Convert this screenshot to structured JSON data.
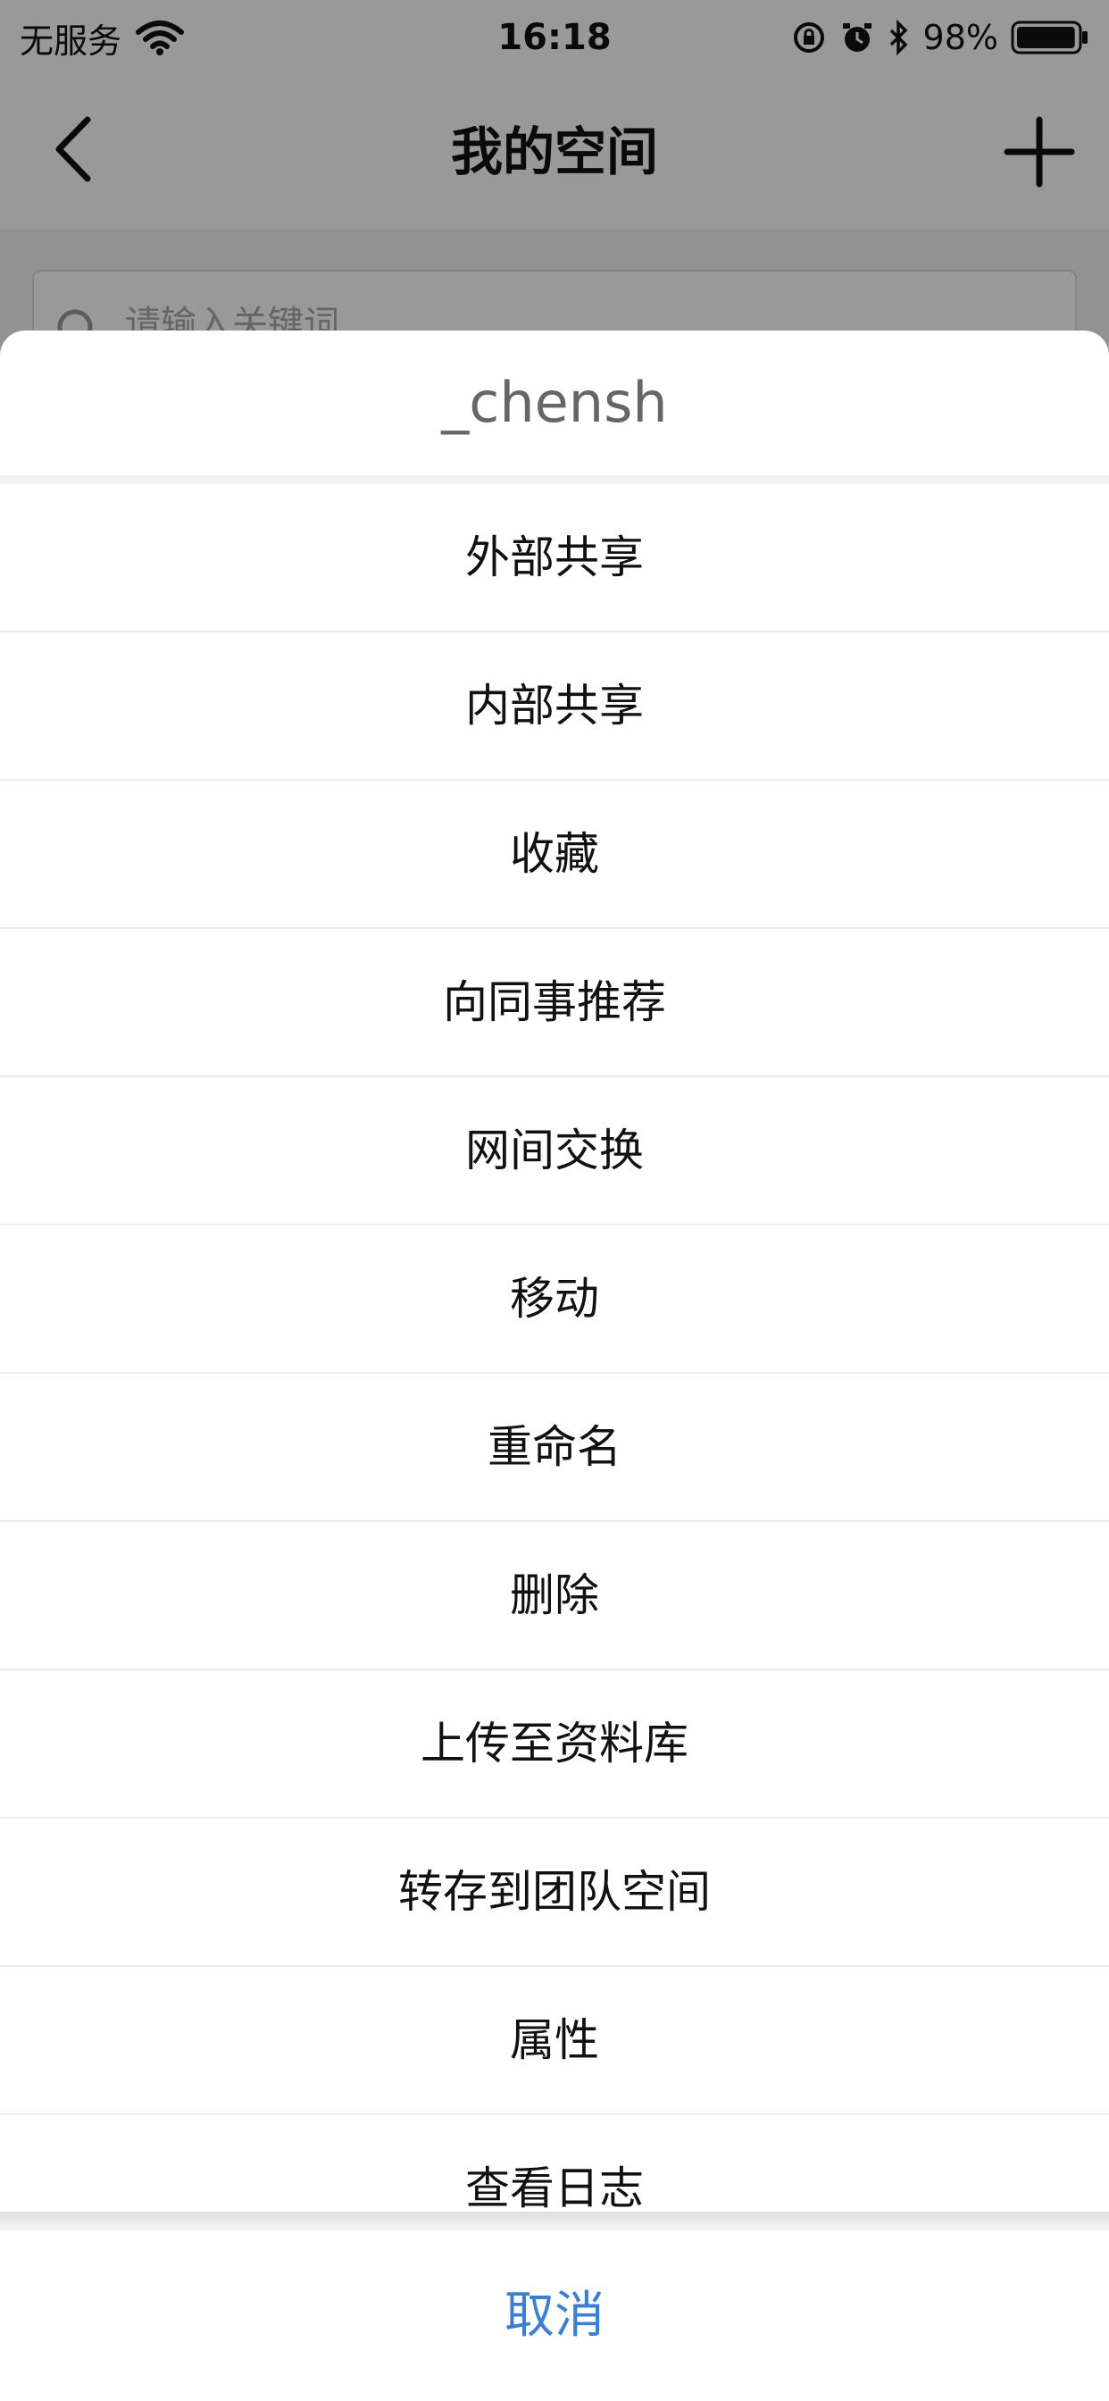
{
  "status_bar": {
    "carrier": "无服务",
    "time": "16:18",
    "battery": "98%",
    "battery_level": 0.98
  },
  "nav": {
    "title": "我的空间",
    "back_icon": "chevron-left-icon",
    "add_icon": "plus-icon"
  },
  "search": {
    "placeholder": "请输入关键词"
  },
  "sheet": {
    "title": "_chensh",
    "items": [
      {
        "label": "外部共享"
      },
      {
        "label": "内部共享"
      },
      {
        "label": "收藏"
      },
      {
        "label": "向同事推荐"
      },
      {
        "label": "网间交换"
      },
      {
        "label": "移动"
      },
      {
        "label": "重命名"
      },
      {
        "label": "删除"
      },
      {
        "label": "上传至资料库"
      },
      {
        "label": "转存到团队空间"
      },
      {
        "label": "属性"
      },
      {
        "label": "查看日志"
      }
    ],
    "cancel_label": "取消"
  },
  "colors": {
    "accent": "#3a7fd2",
    "overlay": "rgba(0,0,0,0.40)"
  }
}
